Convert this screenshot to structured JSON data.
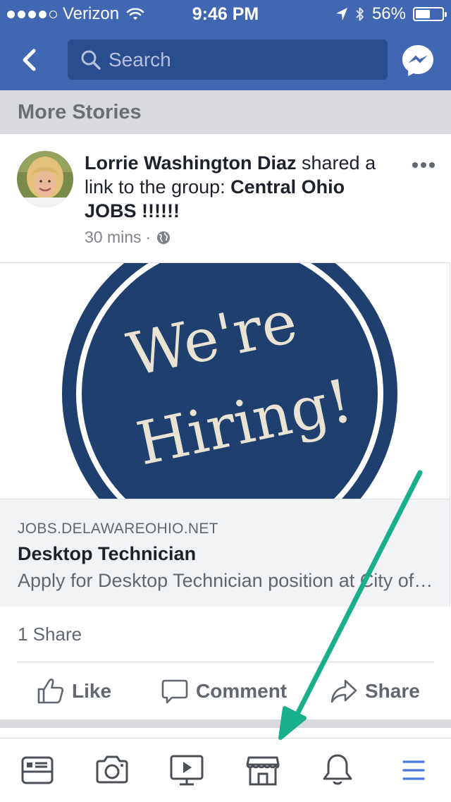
{
  "status_bar": {
    "carrier": "Verizon",
    "time": "9:46 PM",
    "battery": "56%",
    "battery_level": 0.56,
    "signal_bars": 4
  },
  "nav": {
    "search_placeholder": "Search",
    "icons": {
      "back": "chevron-left-icon",
      "search": "search-icon",
      "messenger": "messenger-icon"
    }
  },
  "feed": {
    "section_title": "More Stories",
    "post": {
      "author": "Lorrie Washington Diaz",
      "action_text": " shared a link to the group: ",
      "group": "Central Ohio JOBS !!!!!!",
      "time": "30 mins",
      "separator": "·",
      "privacy_icon": "globe-icon",
      "image_text": {
        "line1": "We're",
        "line2": "Hiring!"
      },
      "link": {
        "domain": "JOBS.DELAWAREOHIO.NET",
        "title": "Desktop Technician",
        "description": "Apply for Desktop Technician position at City of Delaware"
      },
      "share_count": "1 Share",
      "actions": {
        "like": "Like",
        "comment": "Comment",
        "share": "Share"
      }
    }
  },
  "tab_bar": {
    "icons": [
      "news-feed-icon",
      "camera-icon",
      "watch-video-icon",
      "marketplace-icon",
      "notifications-bell-icon",
      "menu-icon"
    ]
  },
  "colors": {
    "brand_blue": "#4267b2",
    "search_bg": "#2a4d90",
    "hiring_navy": "#1f3f6e",
    "arrow_teal": "#1aaf8b",
    "active_tab": "#4a76e0"
  }
}
